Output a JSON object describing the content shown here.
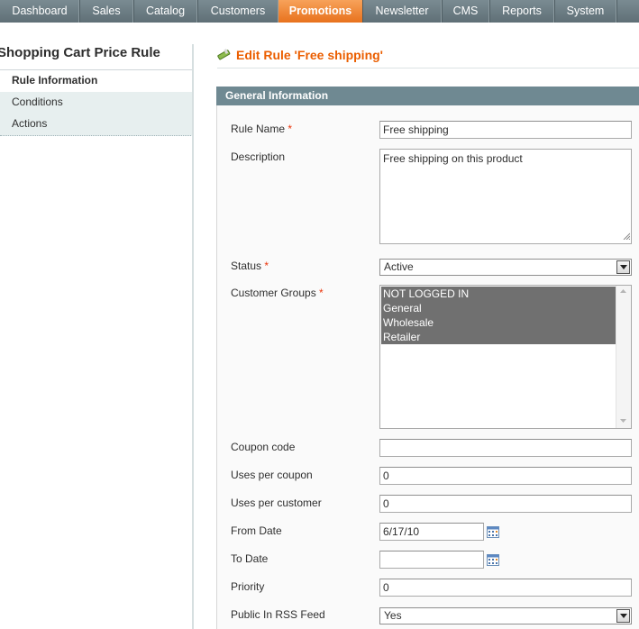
{
  "nav": {
    "items": [
      "Dashboard",
      "Sales",
      "Catalog",
      "Customers",
      "Promotions",
      "Newsletter",
      "CMS",
      "Reports",
      "System"
    ],
    "active": "Promotions",
    "active_color": "#eb7a28",
    "bar_color": "#6f8087"
  },
  "sidebar": {
    "title": "Shopping Cart Price Rule",
    "tabs": [
      {
        "label": "Rule Information",
        "active": true
      },
      {
        "label": "Conditions",
        "active": false
      },
      {
        "label": "Actions",
        "active": false
      }
    ]
  },
  "header": {
    "title": "Edit Rule 'Free shipping'",
    "title_color": "#eb5e00",
    "icon": "pencil-icon"
  },
  "fieldset": {
    "legend": "General Information"
  },
  "form": {
    "rule_name": {
      "label": "Rule Name",
      "value": "Free shipping",
      "required": "*"
    },
    "description": {
      "label": "Description",
      "value": "Free shipping on this product"
    },
    "status": {
      "label": "Status",
      "value": "Active",
      "required": "*"
    },
    "customer_groups": {
      "label": "Customer Groups",
      "required": "*",
      "options": [
        "NOT LOGGED IN",
        "General",
        "Wholesale",
        "Retailer"
      ]
    },
    "coupon_code": {
      "label": "Coupon code",
      "value": ""
    },
    "uses_per_coupon": {
      "label": "Uses per coupon",
      "value": "0"
    },
    "uses_per_customer": {
      "label": "Uses per customer",
      "value": "0"
    },
    "from_date": {
      "label": "From Date",
      "value": "6/17/10",
      "icon": "calendar-icon"
    },
    "to_date": {
      "label": "To Date",
      "value": "",
      "icon": "calendar-icon"
    },
    "priority": {
      "label": "Priority",
      "value": "0"
    },
    "rss": {
      "label": "Public In RSS Feed",
      "value": "Yes"
    }
  }
}
